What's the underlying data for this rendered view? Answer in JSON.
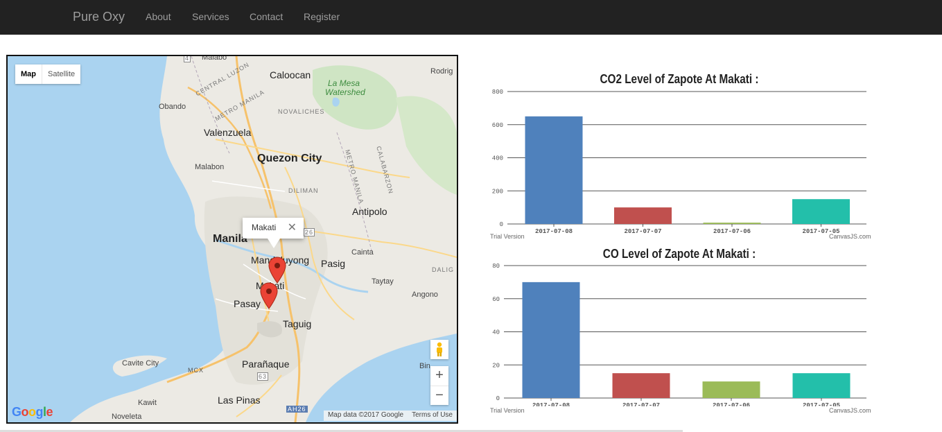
{
  "navbar": {
    "brand": "Pure Oxy",
    "links": [
      "About",
      "Services",
      "Contact",
      "Register"
    ]
  },
  "map": {
    "type_controls": {
      "map": "Map",
      "satellite": "Satellite"
    },
    "infowindow": {
      "label": "Makati",
      "close": "✕"
    },
    "zoom_in": "+",
    "zoom_out": "−",
    "logo": "Google",
    "attribution": "Map data ©2017 Google",
    "terms": "Terms of Use",
    "places": {
      "malabon_top": "Malabo",
      "caloocan": "Caloocan",
      "la_mesa_1": "La Mesa",
      "la_mesa_2": "Watershed",
      "rodriguez": "Rodrig",
      "obando": "Obando",
      "central_luzon": "CENTRAL LUZON",
      "metro_manila_1": "METRO MANILA",
      "novaliches": "NOVALICHES",
      "valenzuela": "Valenzuela",
      "quezon_city": "Quezon City",
      "malabon": "Malabon",
      "metro_manila_2": "METRO MANILA",
      "calabarzon": "CALABARZON",
      "diliman": "DILIMAN",
      "antipolo": "Antipolo",
      "manila": "Manila",
      "mandaluyong": "Mandaluyong",
      "pasig": "Pasig",
      "cainta": "Cainta",
      "makati": "Makati",
      "taytay": "Taytay",
      "dalig": "DALIG",
      "pasay": "Pasay",
      "angono": "Angono",
      "taguig": "Taguig",
      "cavite_city": "Cavite City",
      "binangonan": "Bin",
      "paranaque": "Parañaque",
      "kawit": "Kawit",
      "las_pinas": "Las Pinas",
      "noveleta": "Noveleta",
      "mcx": "MCX",
      "r26": "26",
      "r63": "63",
      "ah26": "AH26",
      "r4": "4"
    }
  },
  "charts": {
    "watermark_left": "Trial Version",
    "watermark_right": "CanvasJS.com"
  },
  "chart_data": [
    {
      "type": "bar",
      "title": "CO2 Level of Zapote At Makati :",
      "categories": [
        "2017-07-08",
        "2017-07-07",
        "2017-07-06",
        "2017-07-05"
      ],
      "values": [
        650,
        100,
        8,
        150
      ],
      "colors": [
        "#4f81bc",
        "#c0504e",
        "#9bbb58",
        "#23bfaa"
      ],
      "ylim": [
        0,
        800
      ],
      "yticks": [
        0,
        200,
        400,
        600,
        800
      ],
      "grid": true
    },
    {
      "type": "bar",
      "title": "CO Level of Zapote At Makati :",
      "categories": [
        "2017-07-08",
        "2017-07-07",
        "2017-07-06",
        "2017-07-05"
      ],
      "values": [
        70,
        15,
        10,
        15
      ],
      "colors": [
        "#4f81bc",
        "#c0504e",
        "#9bbb58",
        "#23bfaa"
      ],
      "ylim": [
        0,
        80
      ],
      "yticks": [
        0,
        20,
        40,
        60,
        80
      ],
      "grid": true
    }
  ]
}
